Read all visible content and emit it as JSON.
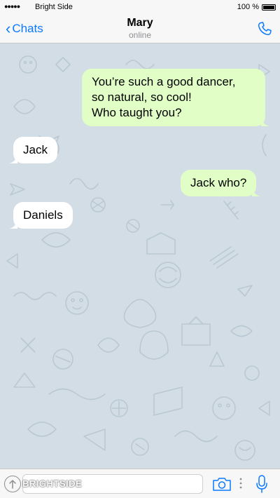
{
  "status_bar": {
    "signal": "●●●●●",
    "carrier": "Bright Side",
    "battery": "100 %"
  },
  "header": {
    "back_label": "Chats",
    "contact_name": "Mary",
    "contact_status": "online",
    "call_icon": "phone-icon"
  },
  "messages": [
    {
      "direction": "outgoing",
      "lines": [
        "You’re such a good dancer,",
        "so natural, so cool!",
        "Who taught you?"
      ]
    },
    {
      "direction": "incoming",
      "text": "Jack"
    },
    {
      "direction": "outgoing",
      "text": "Jack who?"
    },
    {
      "direction": "incoming",
      "text": "Daniels"
    }
  ],
  "input_bar": {
    "attach_icon": "attach-icon",
    "watermark": "BRIGHTSIDE",
    "placeholder": "",
    "camera_icon": "camera-icon",
    "mic_icon": "microphone-icon"
  },
  "colors": {
    "outgoing_bubble": "#e1fec6",
    "incoming_bubble": "#ffffff",
    "chat_background": "#d3dde5",
    "accent": "#0a7aff"
  }
}
